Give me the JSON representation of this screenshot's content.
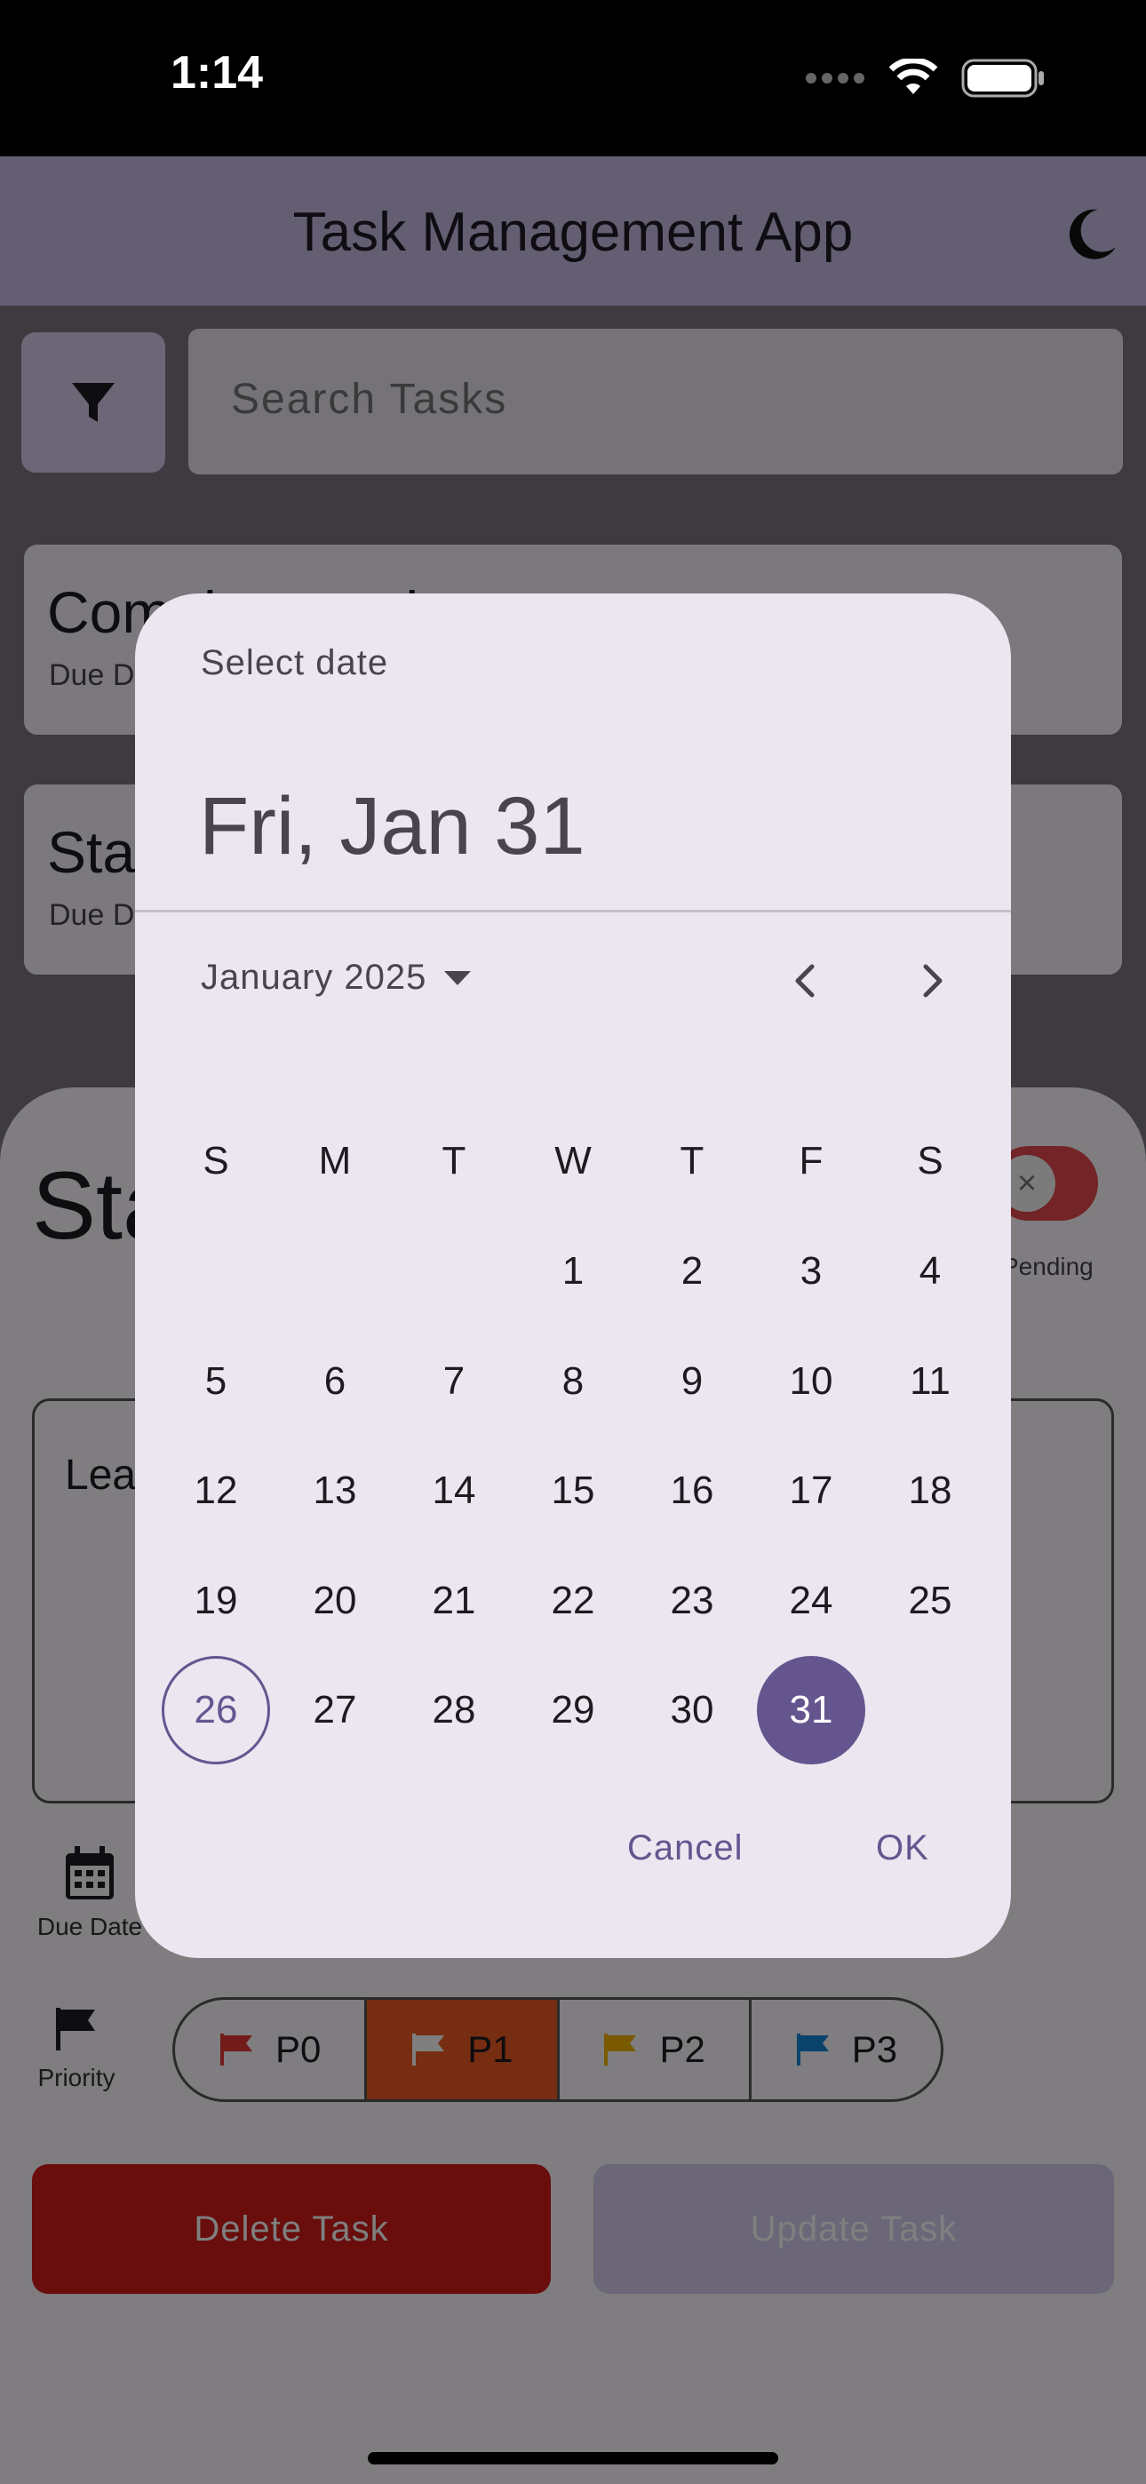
{
  "status_bar": {
    "time": "1:14"
  },
  "app_bar": {
    "title": "Task Management App"
  },
  "search": {
    "placeholder": "Search Tasks"
  },
  "tasks": [
    {
      "title": "Complete assignment",
      "due": "Due Date"
    },
    {
      "title": "Start",
      "due": "Due Date"
    }
  ],
  "sheet": {
    "title": "Start",
    "status_label": "Pending",
    "description": "Learn",
    "due_date_label": "Due Date",
    "priority_label": "Priority",
    "priorities": [
      "P0",
      "P1",
      "P2",
      "P3"
    ],
    "selected_priority": "P1",
    "delete_label": "Delete Task",
    "update_label": "Update Task"
  },
  "date_picker": {
    "help_text": "Select date",
    "headline": "Fri, Jan 31",
    "month_label": "January 2025",
    "weekdays": [
      "S",
      "M",
      "T",
      "W",
      "T",
      "F",
      "S"
    ],
    "first_weekday_index": 3,
    "days_in_month": 31,
    "today": 26,
    "selected": 31,
    "cancel_label": "Cancel",
    "ok_label": "OK",
    "accent_color": "#65558f"
  },
  "colors": {
    "priority_p0": "#e53935",
    "priority_p1": "#ef5a22",
    "priority_p2": "#f2b500",
    "priority_p3": "#1586d6",
    "delete": "#d21a1a"
  }
}
